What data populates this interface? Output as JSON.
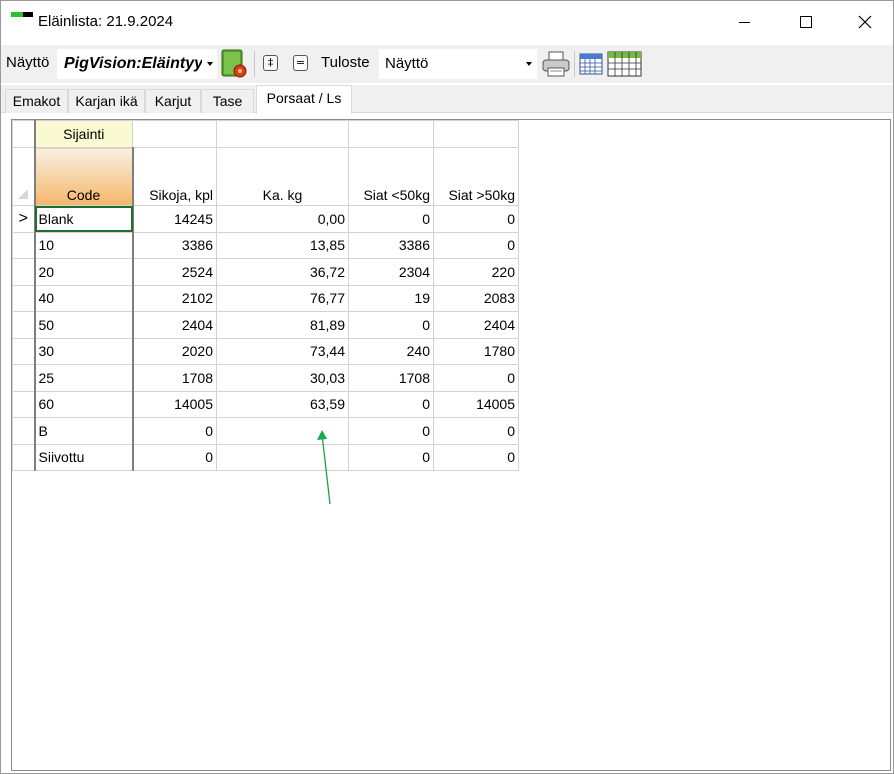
{
  "window": {
    "title": "Eläinlista: 21.9.2024",
    "minimize_label": "",
    "close_glyph": "✕"
  },
  "toolbar": {
    "view_label": "Näyttö",
    "profile_value": "PigVision:Eläintyyppi",
    "expand_glyph": "‡",
    "collapse_glyph": "=",
    "print_label": "Tuloste",
    "print_target_value": "Näyttö"
  },
  "tabs": [
    {
      "label": "Emakot",
      "active": false
    },
    {
      "label": "Karjan ikä",
      "active": false
    },
    {
      "label": "Karjut",
      "active": false
    },
    {
      "label": "Tase",
      "active": false
    },
    {
      "label": "Porsaat / Ls",
      "active": true
    }
  ],
  "grid": {
    "group_header": "Sijainti",
    "current_row_marker": ">",
    "columns": [
      "Code",
      "Sikoja, kpl",
      "Ka. kg",
      "Siat <50kg",
      "Siat >50kg"
    ],
    "rows": [
      [
        "Blank",
        "14245",
        "0,00",
        "0",
        "0"
      ],
      [
        "10",
        "3386",
        "13,85",
        "3386",
        "0"
      ],
      [
        "20",
        "2524",
        "36,72",
        "2304",
        "220"
      ],
      [
        "40",
        "2102",
        "76,77",
        "19",
        "2083"
      ],
      [
        "50",
        "2404",
        "81,89",
        "0",
        "2404"
      ],
      [
        "30",
        "2020",
        "73,44",
        "240",
        "1780"
      ],
      [
        "25",
        "1708",
        "30,03",
        "1708",
        "0"
      ],
      [
        "60",
        "14005",
        "63,59",
        "0",
        "14005"
      ],
      [
        "B",
        "0",
        "",
        "0",
        "0"
      ],
      [
        "Siivottu",
        "0",
        "",
        "0",
        "0"
      ]
    ]
  },
  "colors": {
    "annotation_arrow": "#1aa64a",
    "code_header_gradient_end": "#f5b76a",
    "sijainti_header": "#fafad2",
    "selected_cell_outline": "#1f6e2a"
  }
}
